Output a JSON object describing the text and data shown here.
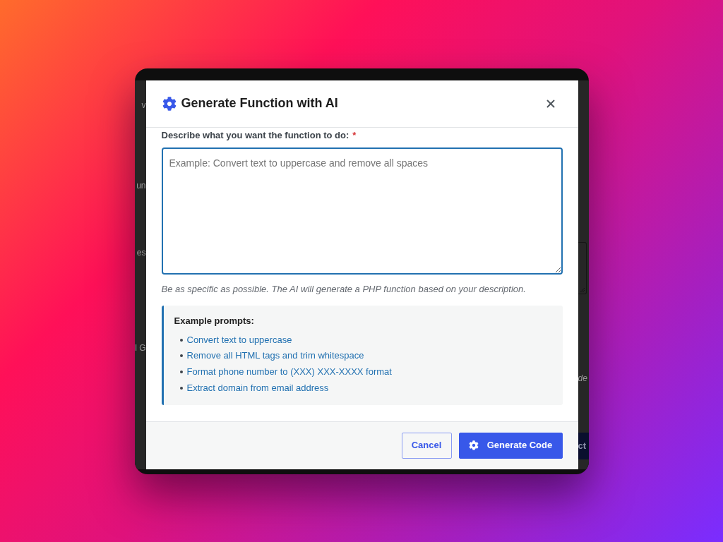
{
  "background_page": {
    "left_texts": [
      "v",
      "un",
      "es",
      "l G"
    ],
    "right_text": "de",
    "right_button": "ct"
  },
  "dialog": {
    "title": "Generate Function with AI",
    "field": {
      "label": "Describe what you want the function to do:",
      "required_mark": "*",
      "placeholder": "Example: Convert text to uppercase and remove all spaces",
      "help": "Be as specific as possible. The AI will generate a PHP function based on your description."
    },
    "examples": {
      "heading": "Example prompts:",
      "items": [
        "Convert text to uppercase",
        "Remove all HTML tags and trim whitespace",
        "Format phone number to (XXX) XXX-XXXX format",
        "Extract domain from email address"
      ]
    },
    "buttons": [
      {
        "label": "Cancel",
        "kind": "secondary"
      },
      {
        "label": "Generate Code",
        "kind": "primary"
      }
    ]
  }
}
